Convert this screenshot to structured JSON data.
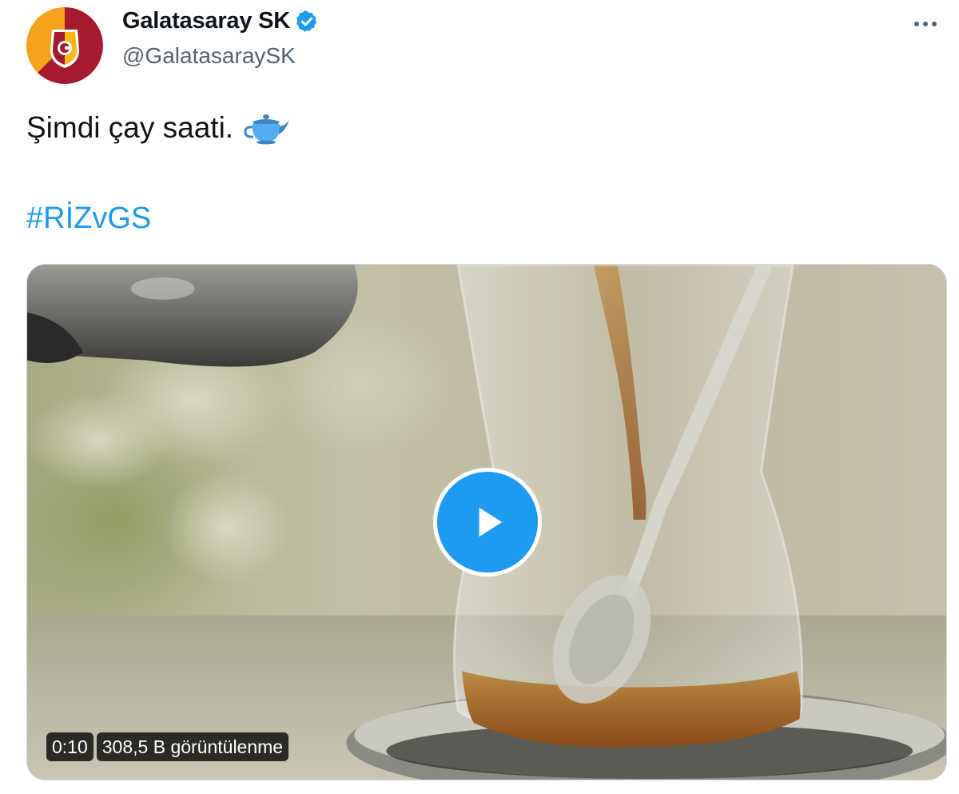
{
  "tweet": {
    "display_name": "Galatasaray SK",
    "handle": "@GalatasaraySK",
    "verified_icon": "verified-badge-icon",
    "more_icon": "more-options-icon",
    "text": "Şimdi çay saati.",
    "emoji_icon": "teapot-icon",
    "hashtag": "#RİZvGS"
  },
  "video": {
    "duration": "0:10",
    "views": "308,5 B görüntülenme",
    "play_icon": "play-icon"
  },
  "colors": {
    "accent": "#1d9bf0",
    "text": "#0f1419",
    "muted": "#536471",
    "avatar_red": "#a6192e",
    "avatar_yellow": "#fdb913"
  }
}
